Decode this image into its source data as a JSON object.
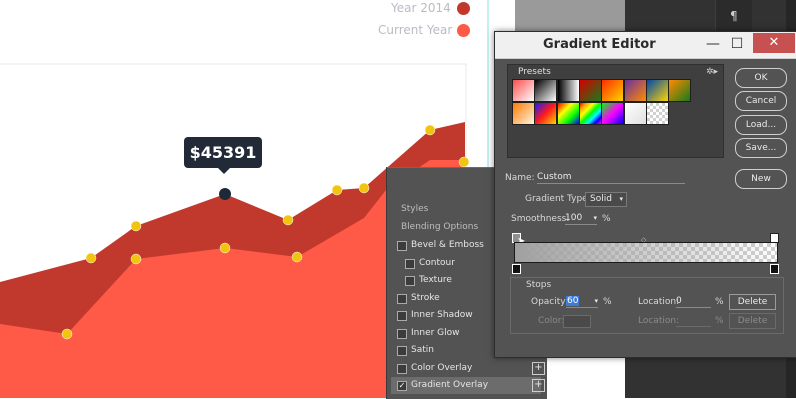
{
  "chart": {
    "legend": [
      {
        "label": "Year 2014",
        "color": "#c0392b"
      },
      {
        "label": "Current Year",
        "color": "#ff5a45"
      }
    ],
    "tooltip_value": "$45391",
    "colors": {
      "series_2014": "#c1392c",
      "series_current": "#ff5a47",
      "marker": "#f1c40f",
      "highlight": "#1e2938"
    }
  },
  "chart_data": {
    "type": "area",
    "series": [
      {
        "name": "Year 2014",
        "values": [
          null,
          92,
          226,
          194,
          220,
          190,
          130,
          162
        ]
      },
      {
        "name": "Current Year",
        "values": [
          334,
          258,
          259,
          248,
          257,
          218,
          188,
          null
        ]
      }
    ],
    "highlight_value": "$45391"
  },
  "styles_panel": {
    "title": "Styles",
    "blending": "Blending Options",
    "items": [
      {
        "label": "Bevel & Emboss",
        "checked": false,
        "indent": false
      },
      {
        "label": "Contour",
        "checked": false,
        "indent": true
      },
      {
        "label": "Texture",
        "checked": false,
        "indent": true
      },
      {
        "label": "Stroke",
        "checked": false,
        "indent": false,
        "plus": false
      },
      {
        "label": "Inner Shadow",
        "checked": false,
        "indent": false
      },
      {
        "label": "Inner Glow",
        "checked": false,
        "indent": false
      },
      {
        "label": "Satin",
        "checked": false,
        "indent": false
      },
      {
        "label": "Color Overlay",
        "checked": false,
        "indent": false,
        "plus": true
      },
      {
        "label": "Gradient Overlay",
        "checked": true,
        "indent": false,
        "plus": true
      }
    ]
  },
  "gradient_editor": {
    "title": "Gradient Editor",
    "presets_label": "Presets",
    "buttons": {
      "ok": "OK",
      "cancel": "Cancel",
      "load": "Load...",
      "save": "Save...",
      "new": "New"
    },
    "name_label": "Name:",
    "name_value": "Custom",
    "gradient_type_label": "Gradient Type:",
    "gradient_type_value": "Solid",
    "smoothness_label": "Smoothness:",
    "smoothness_value": "100",
    "percent": "%",
    "stops_label": "Stops",
    "opacity_label": "Opacity:",
    "opacity_value": "60",
    "location_label": "Location:",
    "location_value": "0",
    "color_label": "Color:",
    "delete_label": "Delete",
    "presets_colors": [
      "#ff3a3a",
      "#1a1a1a",
      "#ffffff",
      "#d40000",
      "#ff6a00",
      "#6b3fa0",
      "#ffd500",
      "#18a03a",
      "#c85a00",
      "#2a2aff",
      "#ff2020",
      "#ff0000",
      "#ff00ff",
      "#ffffff",
      "#d0d0d0"
    ]
  }
}
